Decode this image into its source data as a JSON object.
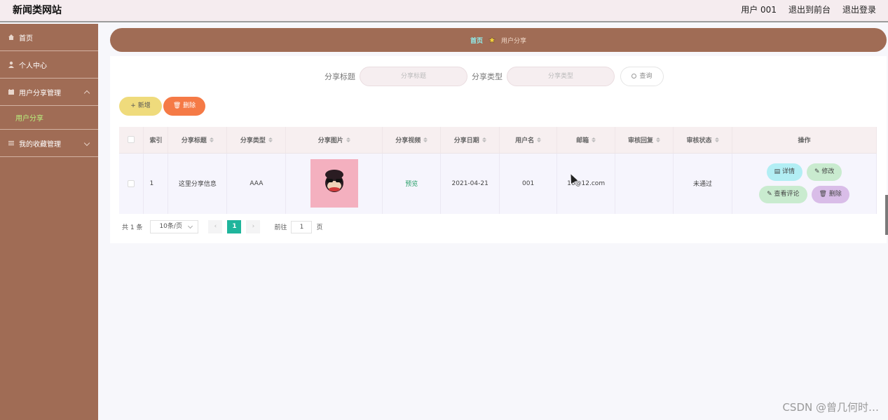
{
  "app": {
    "title": "新闻类网站",
    "user_label": "用户 001",
    "back_to_front": "退出到前台",
    "logout": "退出登录"
  },
  "sidebar": {
    "items": [
      {
        "label": "首页",
        "icon": "home-icon"
      },
      {
        "label": "个人中心",
        "icon": "user-icon"
      },
      {
        "label": "用户分享管理",
        "icon": "calendar-icon",
        "children": [
          {
            "label": "用户分享"
          }
        ]
      },
      {
        "label": "我的收藏管理",
        "icon": "list-icon"
      }
    ]
  },
  "breadcrumb": {
    "home": "首页",
    "current": "用户分享"
  },
  "search": {
    "title_label": "分享标题",
    "title_placeholder": "分享标题",
    "type_label": "分享类型",
    "type_placeholder": "分享类型",
    "query_button": "查询"
  },
  "actions": {
    "add": "新增",
    "delete": "删除"
  },
  "table": {
    "columns": [
      "索引",
      "分享标题",
      "分享类型",
      "分享图片",
      "分享视频",
      "分享日期",
      "用户名",
      "邮箱",
      "审核回复",
      "审核状态",
      "操作"
    ],
    "rows": [
      {
        "index": "1",
        "title": "这里分享信息",
        "type": "AAA",
        "video": "预览",
        "date": "2021-04-21",
        "username": "001",
        "email": "16@12.com",
        "reply": "",
        "status": "未通过",
        "ops": {
          "detail": "详情",
          "edit": "修改",
          "comments": "查看评论",
          "delete": "删除"
        }
      }
    ]
  },
  "pagination": {
    "total": "共 1 条",
    "page_size": "10条/页",
    "current_page": "1",
    "goto_label": "前往",
    "goto_value": "1",
    "page_suffix": "页"
  },
  "watermark": "CSDN @曾几何时…",
  "colors": {
    "sidebar": "#a06c55",
    "topbar": "#f5ecef",
    "active_submenu": "#b9f27e",
    "page_active": "#1fb59c"
  }
}
